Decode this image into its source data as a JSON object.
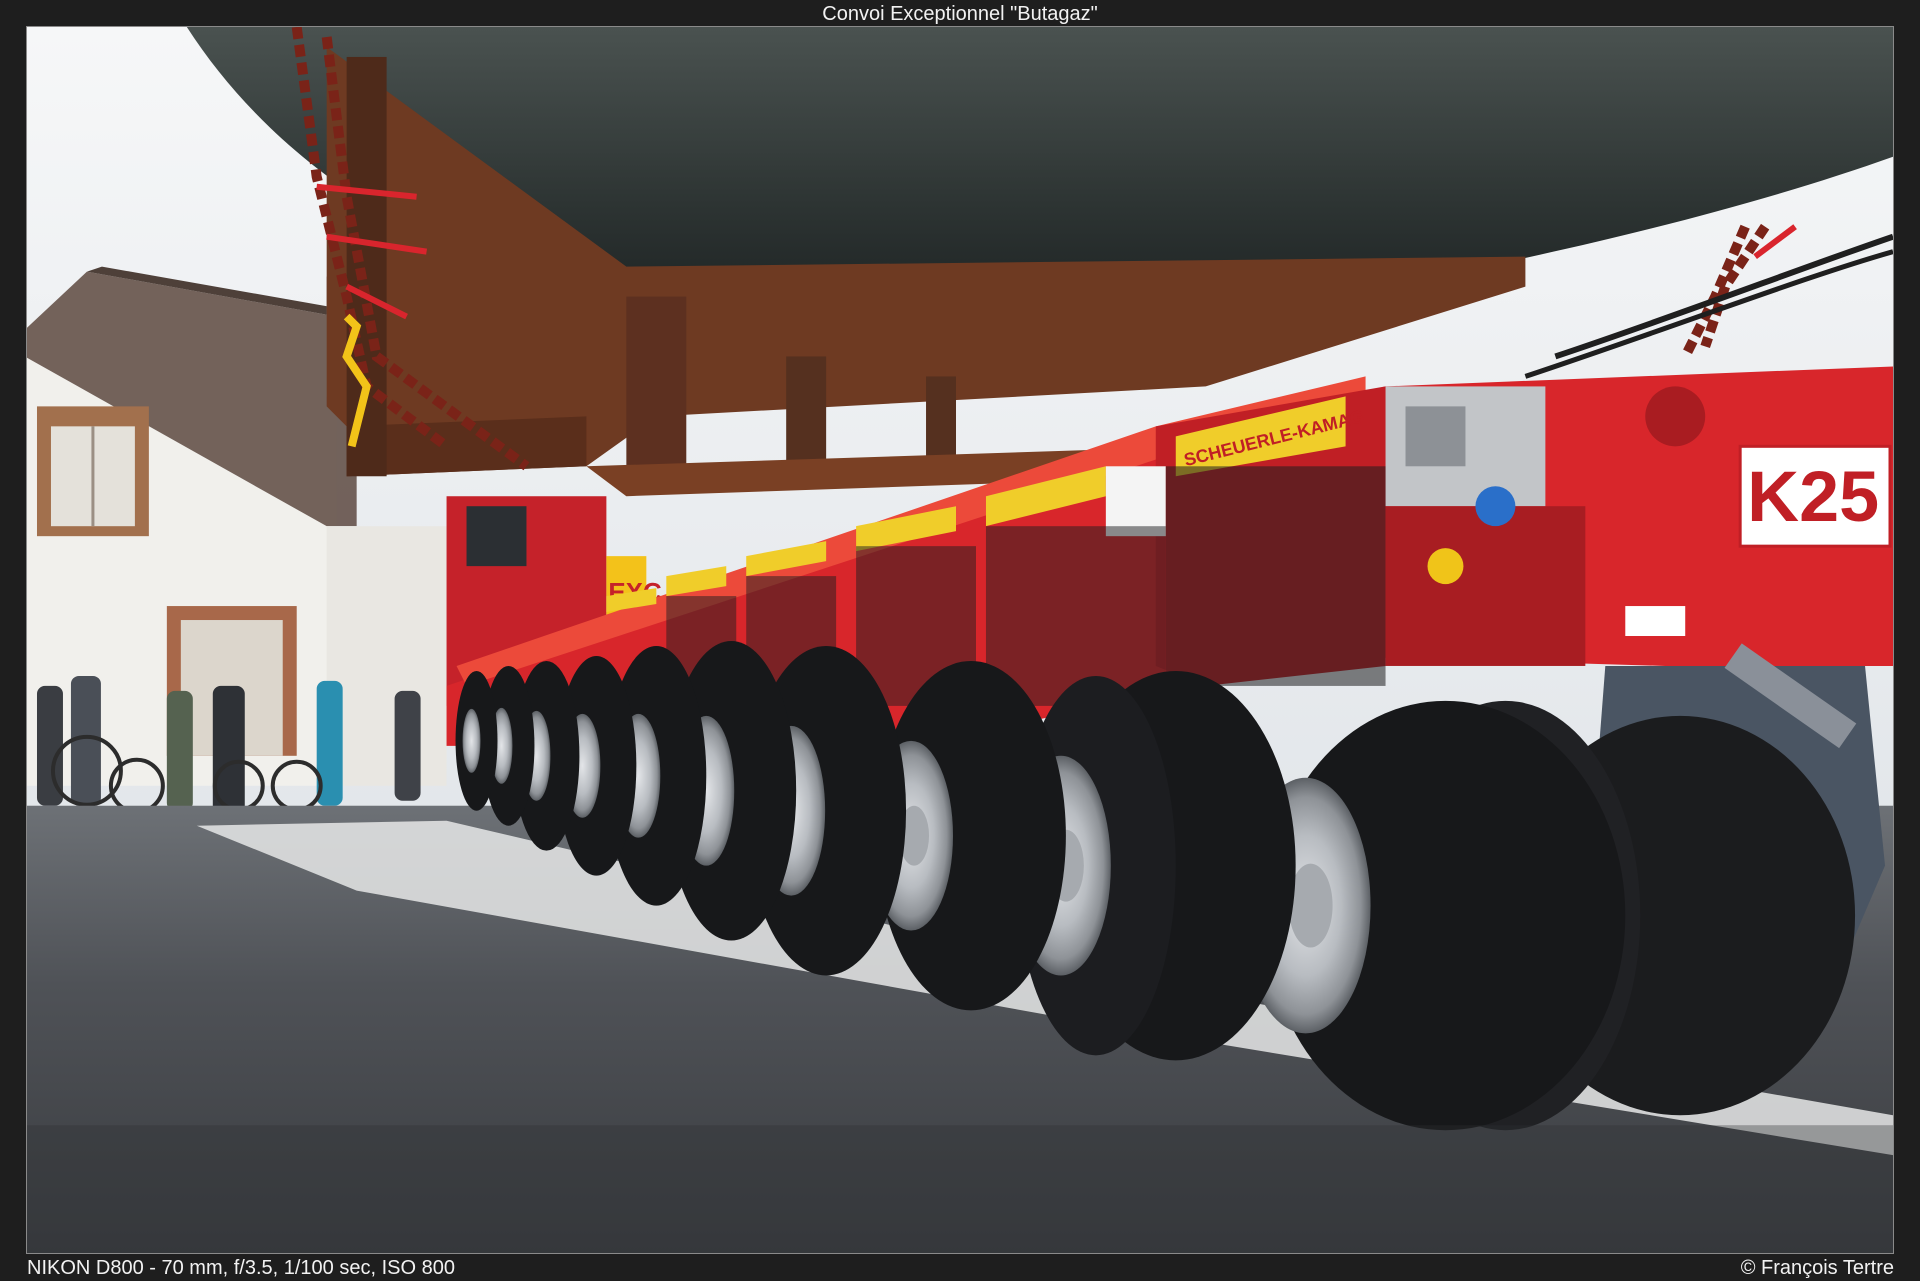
{
  "caption": {
    "title": "Convoi Exceptionnel \"Butagaz\"",
    "camera_info": "NIKON D800 - 70 mm, f/3.5, 1/100 sec, ISO 800",
    "credit": "© François Tertre"
  },
  "photo": {
    "module_brand": "SCHEUERLE-KAMAG",
    "module_badge": "K25",
    "sign_fragment": "EXC",
    "colors": {
      "trailer_red": "#d8262b",
      "tank_dark": "#2e3434",
      "frame_rust": "#6e3a22",
      "asphalt": "#4a4c50",
      "house_wall": "#f1f0ec",
      "roof": "#6b5a52"
    }
  }
}
